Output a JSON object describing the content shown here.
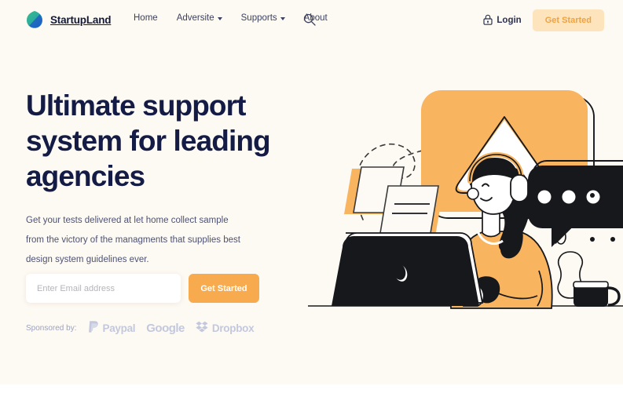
{
  "brand": {
    "name": "StartupLand",
    "icon": "leaf-logo",
    "colors": {
      "green": "#2fb388",
      "blue": "#1e63c8"
    }
  },
  "nav": {
    "links": [
      {
        "label": "Home",
        "has_dropdown": false
      },
      {
        "label": "Adversite",
        "has_dropdown": true
      },
      {
        "label": "Supports",
        "has_dropdown": true
      },
      {
        "label": "About",
        "has_dropdown": false
      }
    ],
    "search_icon": "search-icon",
    "login": {
      "label": "Login",
      "icon": "lock-icon"
    },
    "cta": {
      "label": "Get Started",
      "bg": "#fde4bd",
      "color": "#f0a23f"
    }
  },
  "hero": {
    "headline": "Ultimate support system for leading agencies",
    "paragraph": "Get your tests delivered at let home collect sample from the victory of the managments that supplies best design system guidelines ever.",
    "form": {
      "email_placeholder": "Enter Email address",
      "email_value": "",
      "submit_label": "Get Started",
      "submit_bg": "#f7ab4e"
    },
    "sponsors": {
      "label": "Sponsored by:",
      "brands": [
        {
          "name": "Paypal",
          "icon": "paypal-icon"
        },
        {
          "name": "Google",
          "icon": "google-wordmark"
        },
        {
          "name": "Dropbox",
          "icon": "dropbox-icon"
        }
      ]
    },
    "background": "#fdf9f3",
    "headline_color": "#141b44"
  },
  "illustration": {
    "name": "support-agent-illustration",
    "elements": [
      "orange-speech-bubble-warning",
      "black-speech-bubble-dots",
      "woman-with-headphones",
      "laptop",
      "floating-cards",
      "coffee-mug",
      "dashed-path",
      "dot-grid"
    ],
    "colors": {
      "orange": "#f8b45f",
      "orange_light": "#fbc77f",
      "dark": "#17181c",
      "white": "#ffffff"
    }
  }
}
